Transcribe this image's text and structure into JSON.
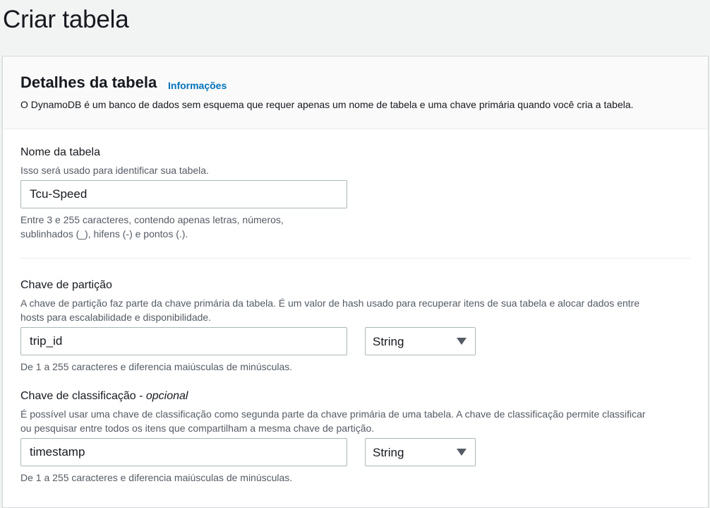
{
  "page": {
    "title": "Criar tabela"
  },
  "details": {
    "title": "Detalhes da tabela",
    "info_link": "Informações",
    "description": "O DynamoDB é um banco de dados sem esquema que requer apenas um nome de tabela e uma chave primária quando você cria a tabela."
  },
  "table_name": {
    "label": "Nome da tabela",
    "description": "Isso será usado para identificar sua tabela.",
    "value": "Tcu-Speed",
    "constraint_line1": "Entre 3 e 255 caracteres, contendo apenas letras, números,",
    "constraint_line2": "sublinhados (_), hifens (-) e pontos (.)."
  },
  "partition_key": {
    "label": "Chave de partição",
    "description_line1": "A chave de partição faz parte da chave primária da tabela. É um valor de hash usado para recuperar itens de sua tabela e alocar dados entre",
    "description_line2": "hosts para escalabilidade e disponibilidade.",
    "value": "trip_id",
    "type": "String",
    "constraint": "De 1 a 255 caracteres e diferencia maiúsculas de minúsculas."
  },
  "sort_key": {
    "label": "Chave de classificação - ",
    "label_optional": "opcional",
    "description_line1": "É possível usar uma chave de classificação como segunda parte da chave primária de uma tabela. A chave de classificação permite classificar",
    "description_line2": "ou pesquisar entre todos os itens que compartilham a mesma chave de partição.",
    "value": "timestamp",
    "type": "String",
    "constraint": "De 1 a 255 caracteres e diferencia maiúsculas de minúsculas."
  },
  "icons": {
    "select_caret": "caret-down-icon"
  },
  "colors": {
    "link": "#0073bb",
    "page_background": "#f2f3f3",
    "header_background": "#fafafa",
    "border": "#aab7b8"
  }
}
